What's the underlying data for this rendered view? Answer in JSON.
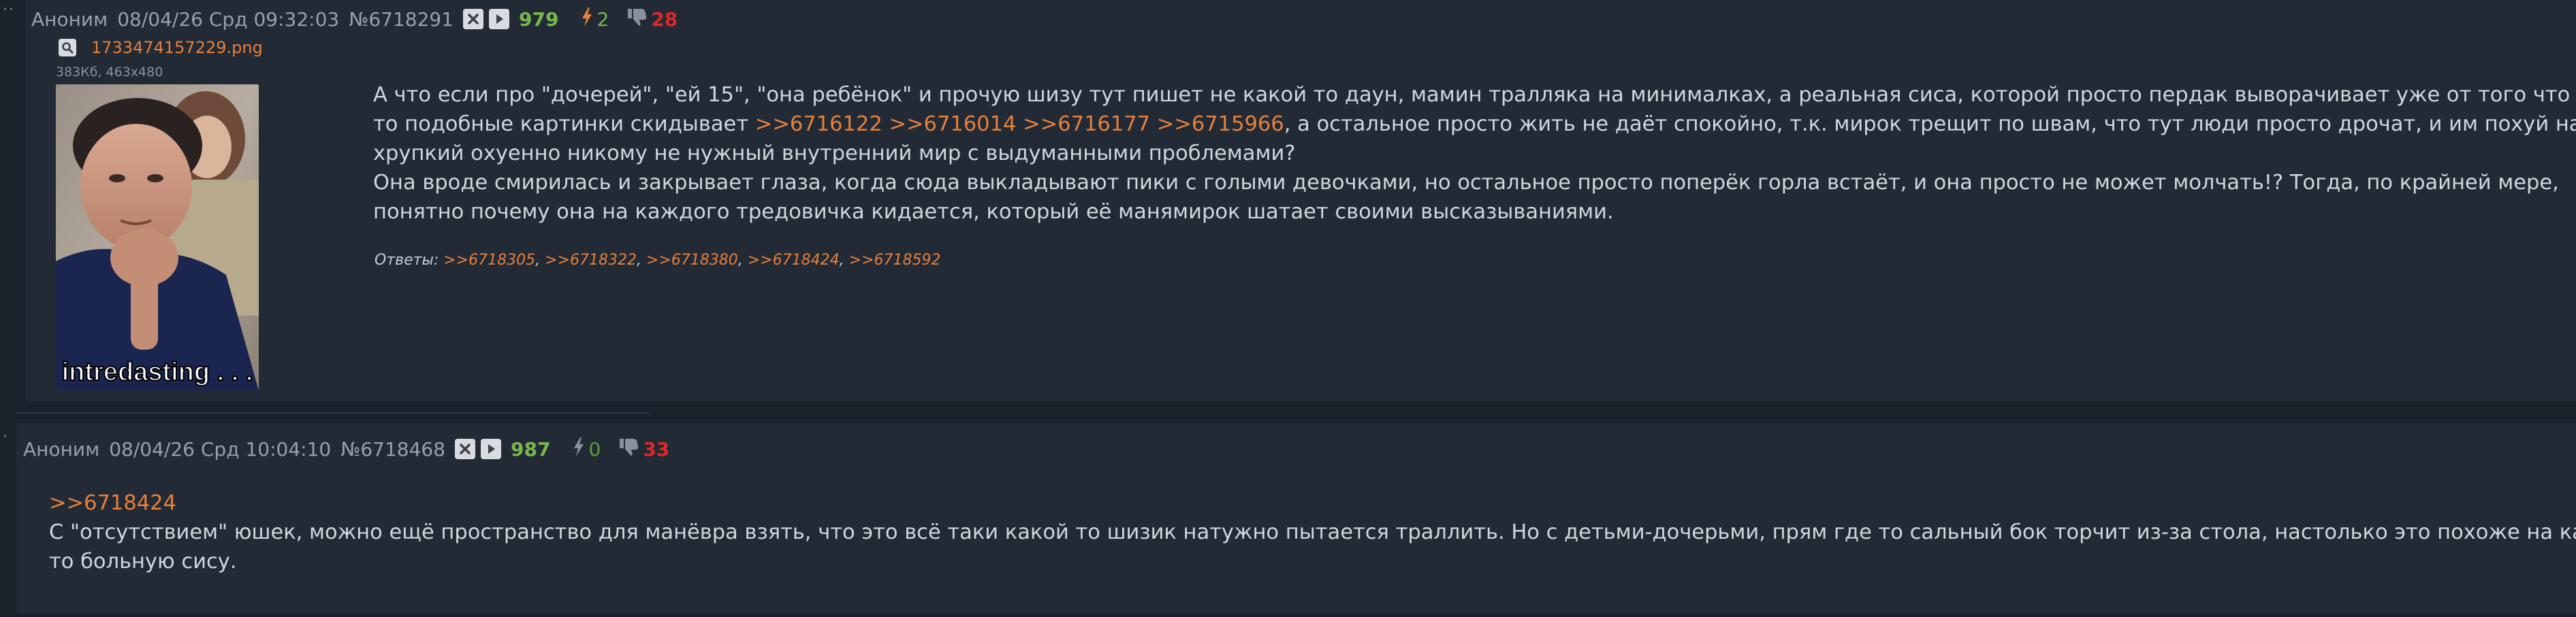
{
  "post1": {
    "author": "Аноним",
    "date": "08/04/26 Срд 09:32:03",
    "number": "№6718291",
    "views": "979",
    "likes": "2",
    "dislikes": "28",
    "file": {
      "name": "1733474157229.png",
      "info": "383Кб, 463x480",
      "caption": "intredasting . . ."
    },
    "message": {
      "l1": "А что если про \"дочерей\", \"ей 15\", \"она ребёнок\" и прочую шизу тут пишет не какой то даун, мамин тралляка на минималках, а реальная сиса, которой просто пердак выворачивает уже от того что кто",
      "l2_a": "то подобные картинки скидывает ",
      "l2_r1": ">>6716122",
      "l2_r2": ">>6716014",
      "l2_r3": ">>6716177",
      "l2_r4": ">>6715966",
      "l2_b": ", а остальное просто жить не даёт спокойно, т.к. мирок трещит по швам, что тут люди просто дрочат, и им похуй на её",
      "l3": "хрупкий охуенно никому не нужный внутренний мир с выдуманными проблемами?",
      "l4": "Она вроде смирилась и закрывает глаза, когда сюда выкладывают пики с голыми девочками, но остальное просто поперёк горла встаёт, и она просто не может молчать!? Тогда, по крайней мере,",
      "l5": "понятно почему она на каждого тредовичка кидается, который её манямирок шатает своими высказываниями."
    },
    "replies_label": "Ответы:",
    "replies": [
      ">>6718305",
      ">>6718322",
      ">>6718380",
      ">>6718424",
      ">>6718592"
    ]
  },
  "post2": {
    "author": "Аноним",
    "date": "08/04/26 Срд 10:04:10",
    "number": "№6718468",
    "views": "987",
    "likes": "0",
    "dislikes": "33",
    "quote_ref": ">>6718424",
    "message": {
      "l1": "С \"отсутствием\" юшек, можно ещё пространство для манёвра взять, что это всё таки какой то шизик натужно пытается траллить. Но с детьми-дочерьми, прям где то сальный бок торчит из-за стола, настолько это похоже на какую",
      "l2": "то больную сису."
    }
  },
  "colors": {
    "background": "#1c222c",
    "post_bg": "#222a36",
    "link": "#e8803a",
    "views_green": "#78b84a",
    "dislike_red": "#e02828",
    "like_orange": "#e8803a",
    "like_green": "#5aa03a"
  },
  "icons": {
    "hide": "close-x-icon",
    "play": "play-icon",
    "like": "lightning-icon",
    "dislike": "thumbs-down-icon",
    "zoom": "magnifier-icon"
  }
}
